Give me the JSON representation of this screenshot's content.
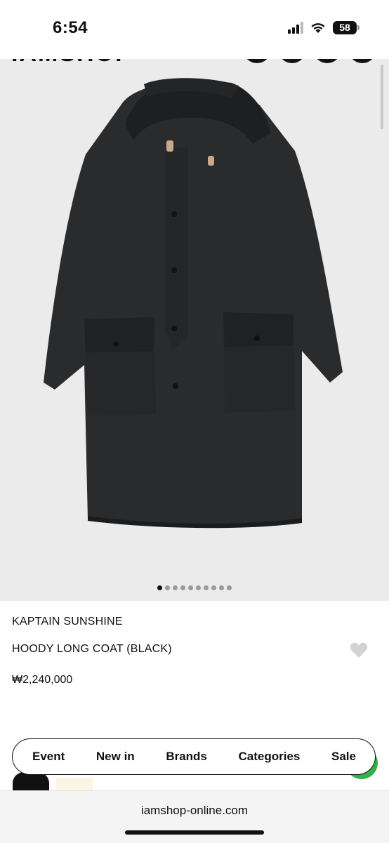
{
  "status_bar": {
    "time": "6:54",
    "battery": "58"
  },
  "header": {
    "logo": "IAMSHOP"
  },
  "product": {
    "brand": "KAPTAIN SUNSHINE",
    "name": "HOODY LONG COAT (BLACK)",
    "price": "₩2,240,000",
    "image_count": 10,
    "active_image_index": 0
  },
  "bottom_nav": {
    "items": [
      {
        "label": "Event"
      },
      {
        "label": "New in"
      },
      {
        "label": "Brands"
      },
      {
        "label": "Categories"
      },
      {
        "label": "Sale"
      }
    ]
  },
  "browser": {
    "url": "iamshop-online.com"
  },
  "colors": {
    "accent_green": "#2db34a",
    "image_bg": "#ebebeb",
    "coat": "#2a2b2d"
  }
}
